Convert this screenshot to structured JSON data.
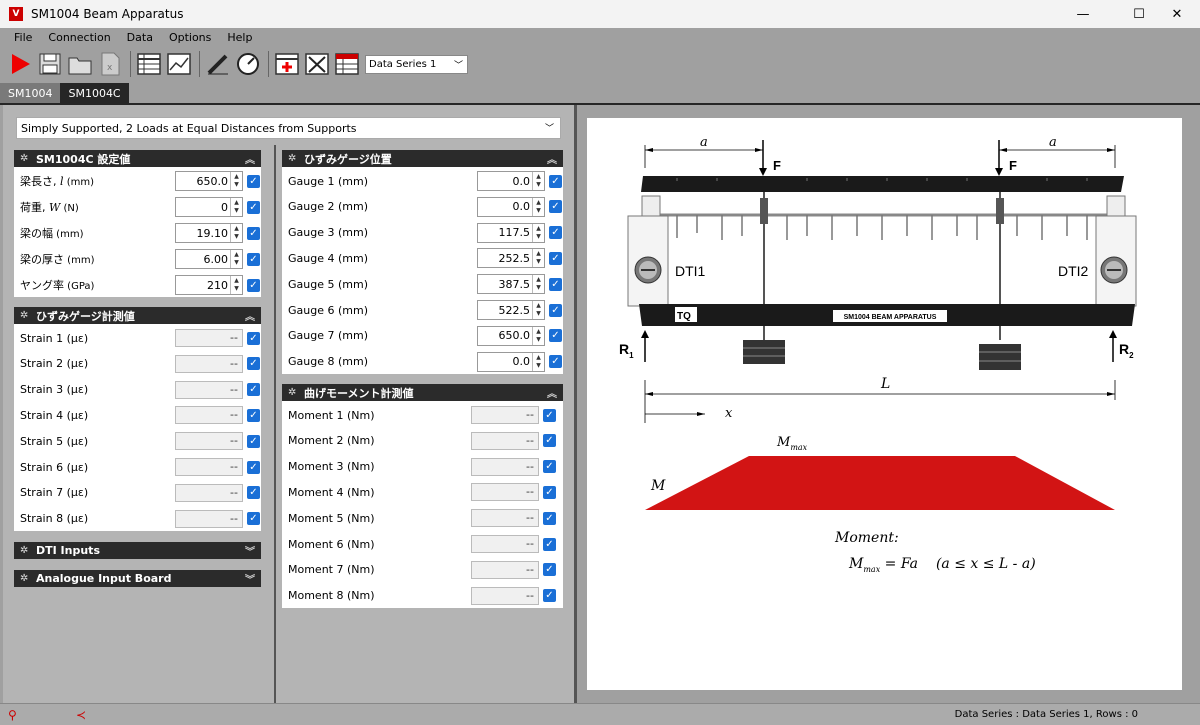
{
  "window": {
    "title": "SM1004 Beam Apparatus",
    "app_icon_letter": "V",
    "minimize": "—",
    "maximize": "☐",
    "close": "✕"
  },
  "menu": [
    "File",
    "Connection",
    "Data",
    "Options",
    "Help"
  ],
  "toolbar": {
    "series_select": "Data Series 1"
  },
  "tabs": [
    "SM1004",
    "SM1004C"
  ],
  "config_select": "Simply Supported, 2 Loads at Equal Distances from Supports",
  "settings_panel": {
    "title": "SM1004C 設定値",
    "rows": [
      {
        "label": "梁長さ, ",
        "var": "l",
        "unit": " (mm)",
        "value": "650.0"
      },
      {
        "label": "荷重, ",
        "var": "W",
        "unit": " (N)",
        "value": "0"
      },
      {
        "label": "梁の幅",
        "var": "",
        "unit": " (mm)",
        "value": "19.10"
      },
      {
        "label": "梁の厚さ",
        "var": "",
        "unit": " (mm)",
        "value": "6.00"
      },
      {
        "label": "ヤング率",
        "var": "",
        "unit": " (GPa)",
        "value": "210"
      }
    ]
  },
  "strain_panel": {
    "title": "ひずみゲージ計測値",
    "rows": [
      {
        "label": "Strain 1 (με)",
        "value": "--"
      },
      {
        "label": "Strain 2 (με)",
        "value": "--"
      },
      {
        "label": "Strain 3 (με)",
        "value": "--"
      },
      {
        "label": "Strain 4 (με)",
        "value": "--"
      },
      {
        "label": "Strain 5 (με)",
        "value": "--"
      },
      {
        "label": "Strain 6 (με)",
        "value": "--"
      },
      {
        "label": "Strain 7 (με)",
        "value": "--"
      },
      {
        "label": "Strain 8 (με)",
        "value": "--"
      }
    ]
  },
  "dti_panel": {
    "title": "DTI Inputs"
  },
  "analogue_panel": {
    "title": "Analogue Input Board"
  },
  "gauge_panel": {
    "title": "ひずみゲージ位置",
    "rows": [
      {
        "label": "Gauge 1 (mm)",
        "value": "0.0"
      },
      {
        "label": "Gauge 2 (mm)",
        "value": "0.0"
      },
      {
        "label": "Gauge 3 (mm)",
        "value": "117.5"
      },
      {
        "label": "Gauge 4 (mm)",
        "value": "252.5"
      },
      {
        "label": "Gauge 5 (mm)",
        "value": "387.5"
      },
      {
        "label": "Gauge 6 (mm)",
        "value": "522.5"
      },
      {
        "label": "Gauge 7 (mm)",
        "value": "650.0"
      },
      {
        "label": "Gauge 8 (mm)",
        "value": "0.0"
      }
    ]
  },
  "moment_panel": {
    "title": "曲げモーメント計測値",
    "rows": [
      {
        "label": "Moment 1 (Nm)",
        "value": "--"
      },
      {
        "label": "Moment 2 (Nm)",
        "value": "--"
      },
      {
        "label": "Moment 3 (Nm)",
        "value": "--"
      },
      {
        "label": "Moment 4 (Nm)",
        "value": "--"
      },
      {
        "label": "Moment 5 (Nm)",
        "value": "--"
      },
      {
        "label": "Moment 6 (Nm)",
        "value": "--"
      },
      {
        "label": "Moment 7 (Nm)",
        "value": "--"
      },
      {
        "label": "Moment 8 (Nm)",
        "value": "--"
      }
    ]
  },
  "diagram": {
    "a_left": "a",
    "a_right": "a",
    "force_left": "F",
    "force_right": "F",
    "dti1": "DTI1",
    "dti2": "DTI2",
    "plate": "SM1004 BEAM APPARATUS",
    "logo": "TQ",
    "r1": "R",
    "r1_sub": "1",
    "r2": "R",
    "r2_sub": "2",
    "L": "L",
    "x": "x",
    "M": "M",
    "Mmax": "M",
    "Mmax_sub": "max",
    "moment_title": "Moment:",
    "formula_m": "M",
    "formula_sub": "max",
    "formula_rhs": " = Fa",
    "formula_range": "(a ≤ x ≤ L - a)",
    "moment_color": "#d21414"
  },
  "status": {
    "text": "Data Series : Data Series 1,  Rows : 0"
  }
}
